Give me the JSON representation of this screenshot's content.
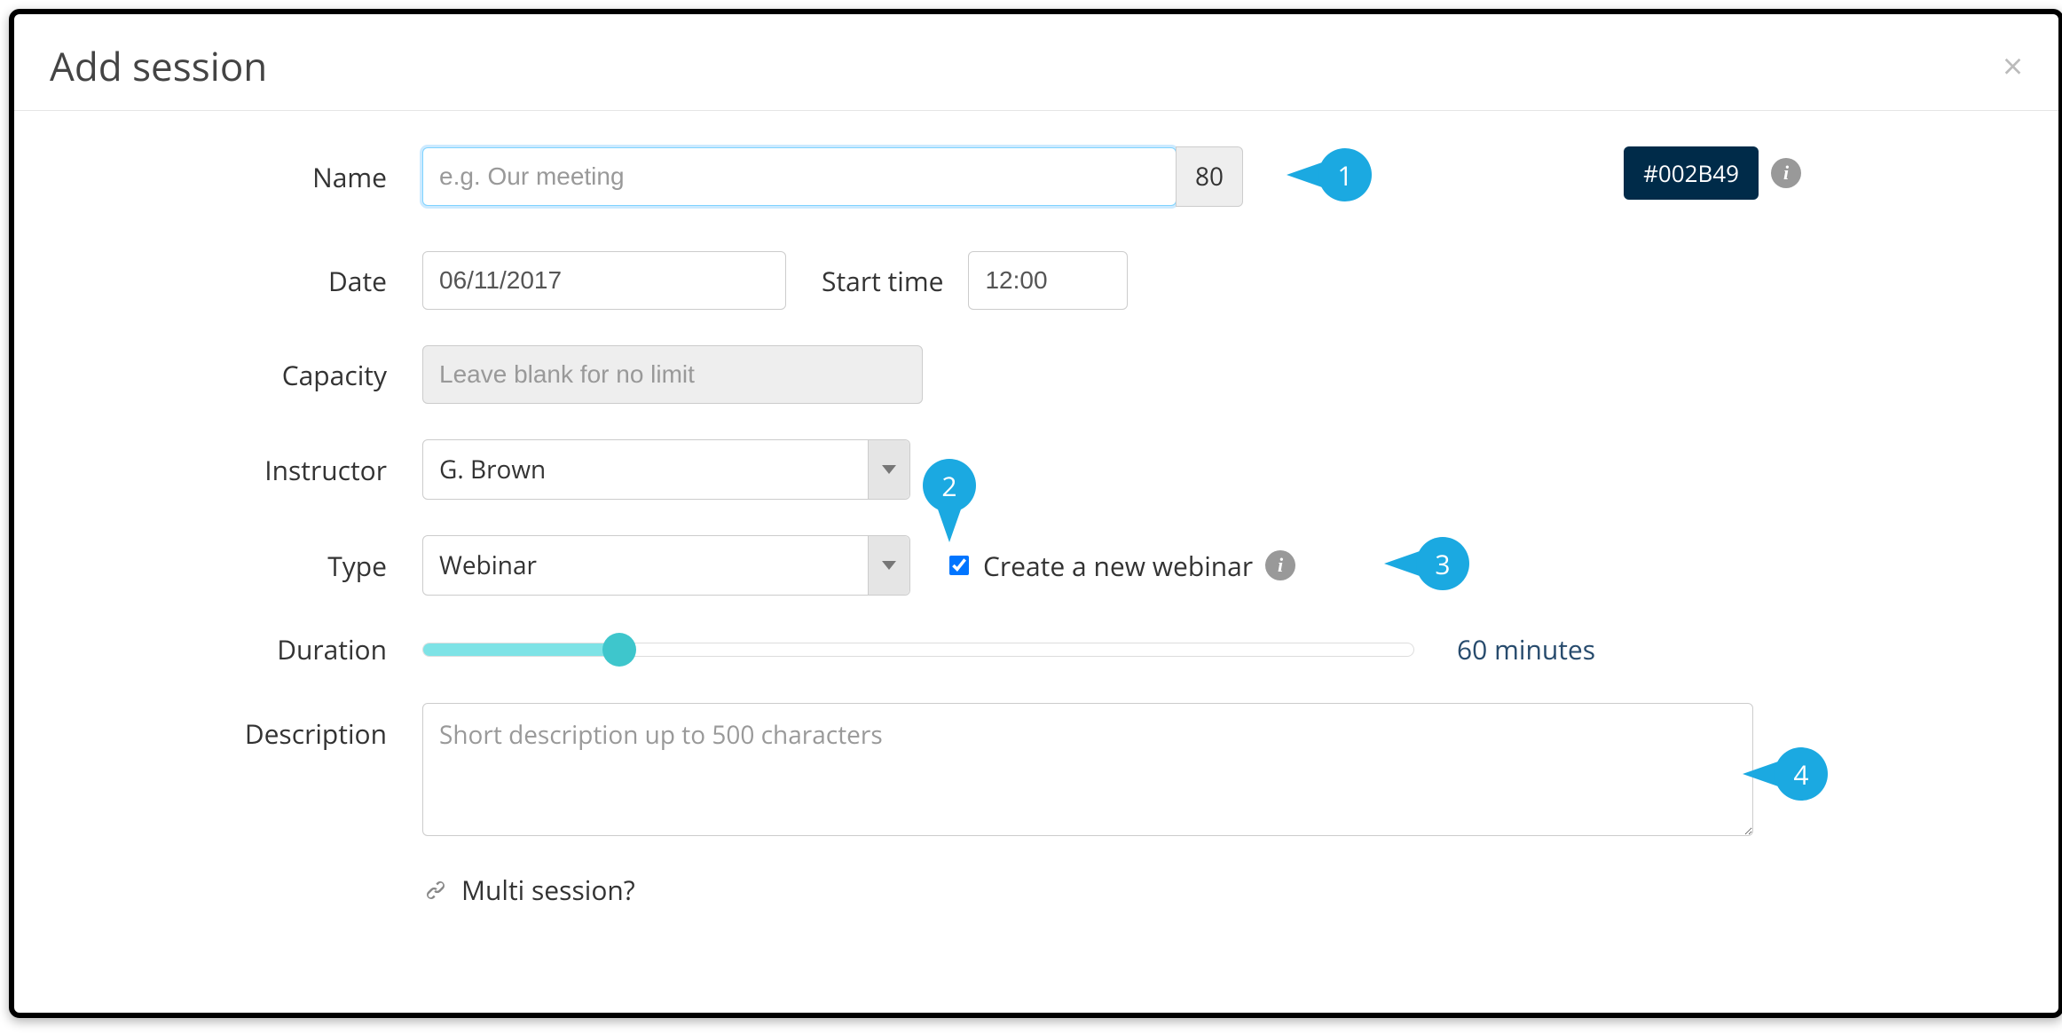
{
  "dialog": {
    "title": "Add session"
  },
  "form": {
    "name": {
      "label": "Name",
      "placeholder": "e.g. Our meeting",
      "value": "",
      "maxlength_remaining": "80"
    },
    "date": {
      "label": "Date",
      "value": "06/11/2017"
    },
    "start_time": {
      "label": "Start time",
      "value": "12:00"
    },
    "capacity": {
      "label": "Capacity",
      "placeholder": "Leave blank for no limit",
      "value": ""
    },
    "instructor": {
      "label": "Instructor",
      "value": "G. Brown"
    },
    "type": {
      "label": "Type",
      "value": "Webinar"
    },
    "create_webinar": {
      "label": "Create a new webinar",
      "checked": true
    },
    "duration": {
      "label": "Duration",
      "display": "60 minutes"
    },
    "description": {
      "label": "Description",
      "placeholder": "Short description up to 500 characters",
      "value": ""
    },
    "multi_session": {
      "label": "Multi session?"
    },
    "color": {
      "hex": "#002B49"
    }
  },
  "callouts": {
    "c1": "1",
    "c2": "2",
    "c3": "3",
    "c4": "4"
  }
}
